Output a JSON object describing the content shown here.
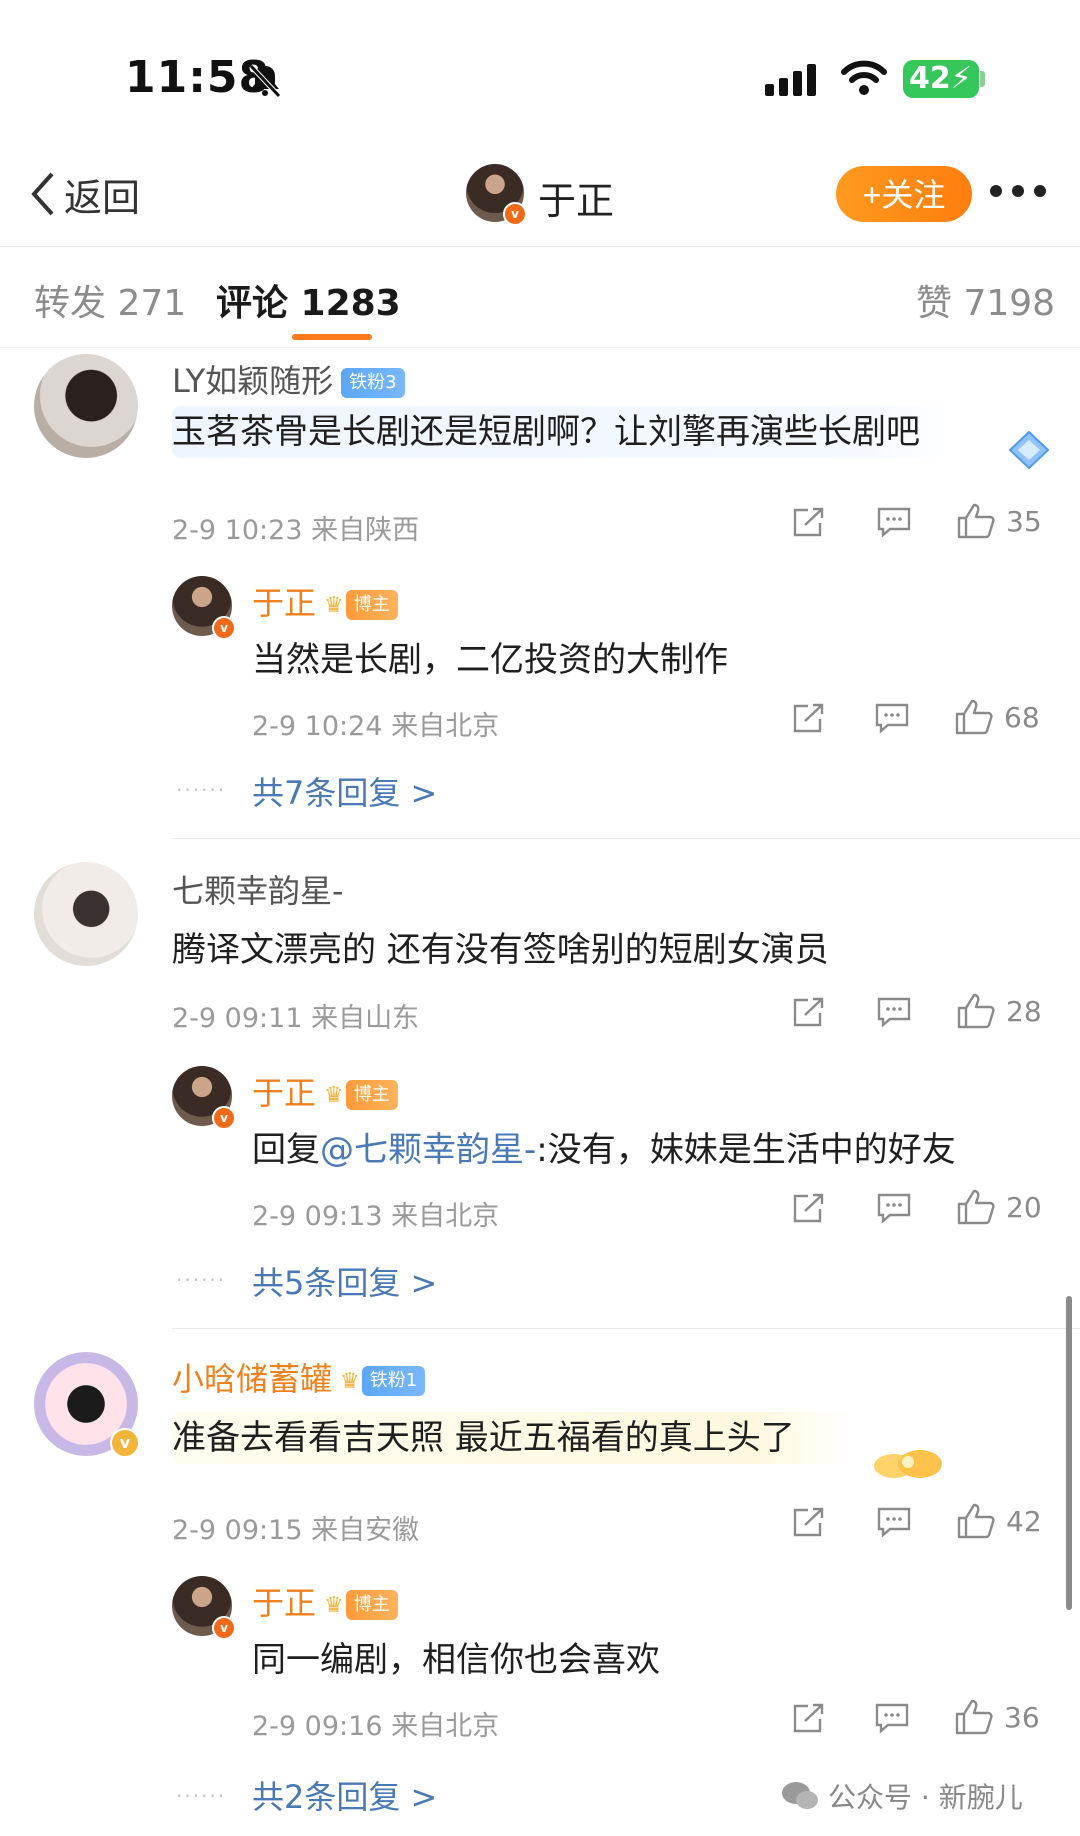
{
  "status_bar": {
    "time": "11:58",
    "battery": "42"
  },
  "nav": {
    "back_label": "返回",
    "title": "于正",
    "follow_label": "+关注"
  },
  "tabs": {
    "repost": "转发 271",
    "comments": "评论 1283",
    "likes": "赞 7198"
  },
  "comments": [
    {
      "user": "LY如颖随形",
      "badge": "铁粉3",
      "text": "玉茗茶骨是长剧还是短剧啊？让刘擎再演些长剧吧",
      "meta": "2-9 10:23 来自陕西",
      "likes": "35",
      "reply": {
        "user": "于正",
        "badge": "博主",
        "text": "当然是长剧，二亿投资的大制作",
        "meta": "2-9 10:24 来自北京",
        "likes": "68"
      },
      "more_replies": "共7条回复 >"
    },
    {
      "user": "七颗幸韵星-",
      "text": "腾译文漂亮的 还有没有签啥别的短剧女演员",
      "meta": "2-9 09:11 来自山东",
      "likes": "28",
      "reply": {
        "user": "于正",
        "badge": "博主",
        "text_prefix": "回复",
        "mention": "@七颗幸韵星-",
        "text_suffix": ":没有，妹妹是生活中的好友",
        "meta": "2-9 09:13 来自北京",
        "likes": "20"
      },
      "more_replies": "共5条回复 >"
    },
    {
      "user": "小晗储蓄罐",
      "badge": "铁粉1",
      "text": "准备去看看吉天照  最近五福看的真上头了",
      "meta": "2-9 09:15 来自安徽",
      "likes": "42",
      "reply": {
        "user": "于正",
        "badge": "博主",
        "text": "同一编剧，相信你也会喜欢",
        "meta": "2-9 09:16 来自北京",
        "likes": "36"
      },
      "more_replies": "共2条回复 >"
    }
  ],
  "watermark": "公众号 · 新腕儿",
  "colors": {
    "accent": "#ff7a1a",
    "link": "#4a7ab6",
    "orange_name": "#f0821e"
  }
}
